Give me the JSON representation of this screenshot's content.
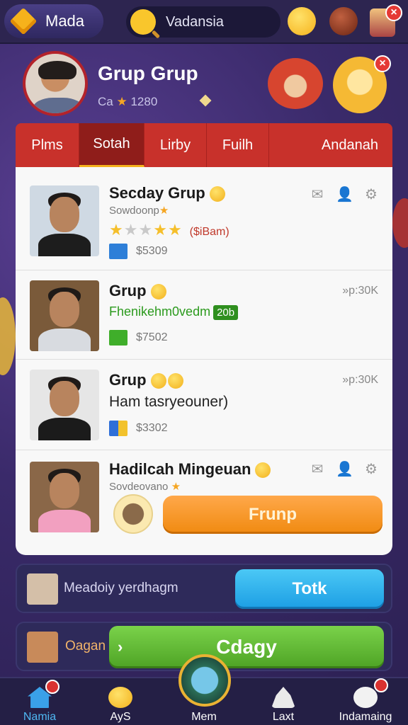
{
  "topbar": {
    "brand": "Mada",
    "search_text": "Vadansia"
  },
  "profile": {
    "title": "Grup Grup",
    "sub_prefix": "Ca",
    "sub_value": "1280"
  },
  "tabs": [
    "Plms",
    "Sotah",
    "Lirby",
    "Fuilh",
    "Andanah"
  ],
  "rows": [
    {
      "title": "Secday Grup",
      "subtitle": "Sowdoonp",
      "stars_note": "($iBam)",
      "price": "$5309"
    },
    {
      "title": "Grup",
      "green_text": "Fhenikehm0vedm",
      "green_tag": "20b",
      "meta": "»p:30K",
      "price": "$7502"
    },
    {
      "title": "Grup",
      "subtitle": "Ham tasryeouner)",
      "meta": "»p:30K",
      "price": "$3302"
    },
    {
      "title": "Hadilcah Mingeuan",
      "subtitle": "Sovdeovano",
      "button": "Frunp"
    }
  ],
  "panel1": {
    "text": "Meadoiy yerdhagm",
    "button": "Totk"
  },
  "panel2": {
    "text": "Oagan",
    "button": "Cdagy"
  },
  "nav": {
    "home": "Namia",
    "ays": "AyS",
    "mem": "Mem",
    "laxt": "Laxt",
    "ind": "Indamaing"
  },
  "colors": {
    "tab_bar": "#c8312b",
    "tab_active": "#8f1d1a",
    "frunp_button": "#f08a10",
    "totik_button": "#1c9ee4",
    "cdagy_button": "#4ea325",
    "nav_active": "#4fb8f2"
  },
  "icons": [
    "search-icon",
    "envelope-icon",
    "user-icon",
    "gear-icon",
    "home-icon",
    "cube-icon",
    "star-icon"
  ]
}
